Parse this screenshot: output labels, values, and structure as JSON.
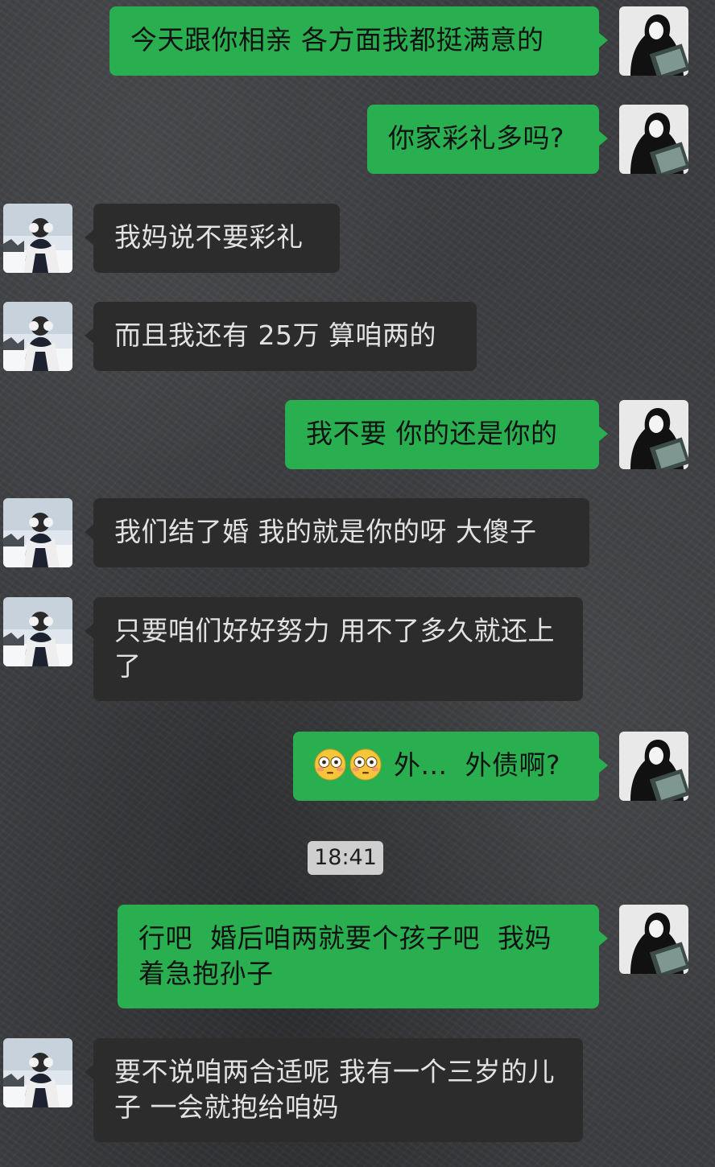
{
  "conversation": {
    "timestamp": "18:41",
    "messages": [
      {
        "sender": "self",
        "text": "今天跟你相亲 各方面我都挺满意的"
      },
      {
        "sender": "self",
        "text": "你家彩礼多吗?"
      },
      {
        "sender": "other",
        "text": "我妈说不要彩礼"
      },
      {
        "sender": "other",
        "text": "而且我还有 25万 算咱两的"
      },
      {
        "sender": "self",
        "text": "我不要 你的还是你的"
      },
      {
        "sender": "other",
        "text": "我们结了婚 我的就是你的呀 大傻子"
      },
      {
        "sender": "other",
        "text": "只要咱们好好努力 用不了多久就还上了"
      },
      {
        "sender": "self",
        "emojis": [
          "flushed-face",
          "flushed-face"
        ],
        "text": "外...  外债啊?"
      },
      {
        "sender": "self",
        "text": "行吧  婚后咱两就要个孩子吧  我妈着急抱孙子"
      },
      {
        "sender": "other",
        "text": "要不说咱两合适呢 我有一个三岁的儿子 一会就抱给咱妈"
      }
    ]
  },
  "colors": {
    "outgoing_bubble": "#29ae50",
    "incoming_bubble": "#2c2c2c",
    "background": "#3b3d40"
  }
}
